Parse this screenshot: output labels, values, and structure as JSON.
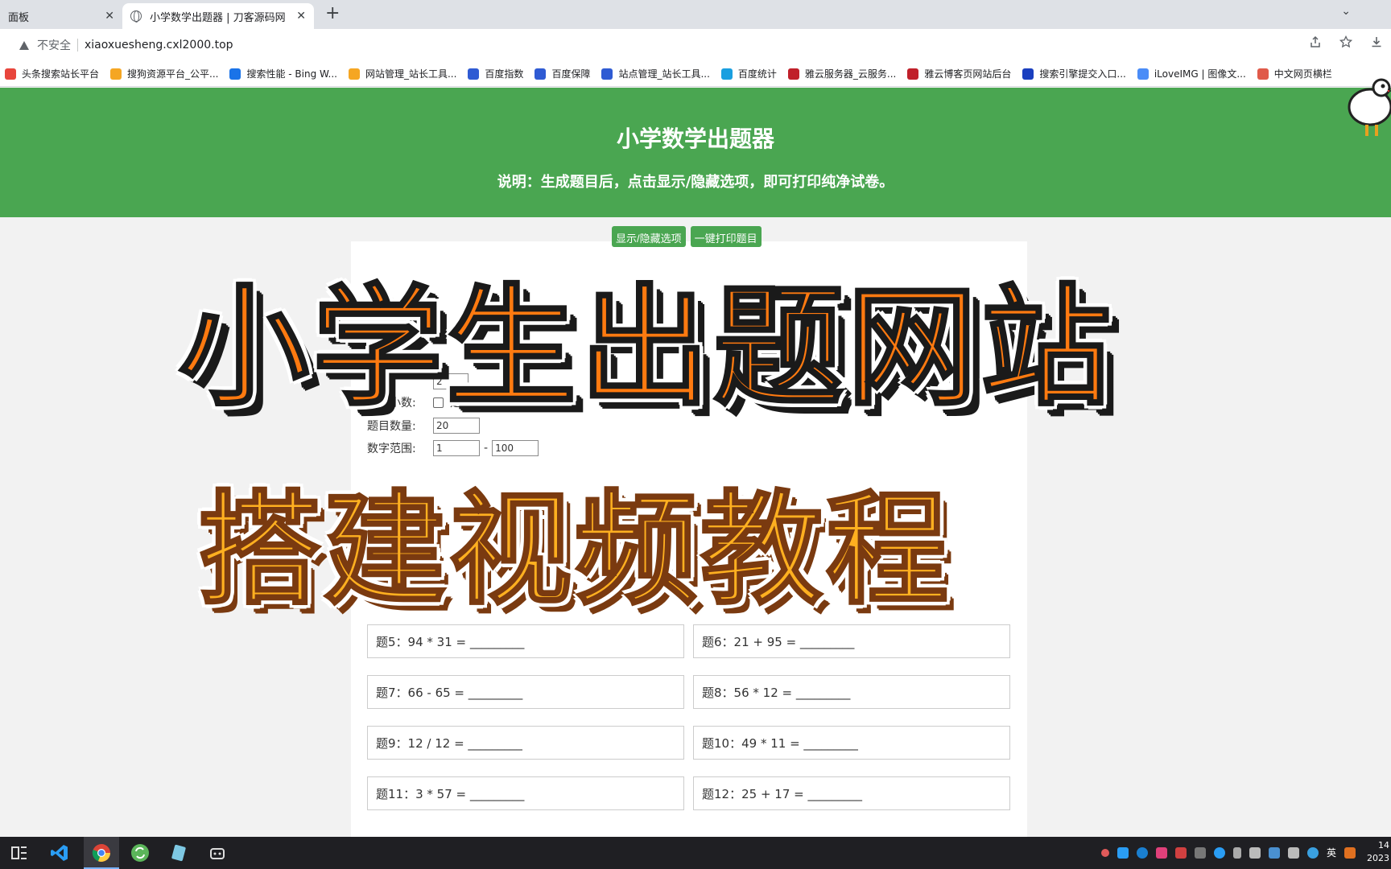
{
  "browser": {
    "tabs": [
      {
        "title": "面板",
        "active": false
      },
      {
        "title": "小学数学出题器 | 刀客源码网",
        "active": true
      }
    ],
    "close_glyph": "✕",
    "new_tab_glyph": "+",
    "tab_menu_glyph": "⌄",
    "insecure_label": "不安全",
    "url": "xiaoxuesheng.cxl2000.top",
    "bookmarks": [
      {
        "label": "头条搜索站长平台",
        "color": "#e8453c"
      },
      {
        "label": "搜狗资源平台_公平...",
        "color": "#f5a623"
      },
      {
        "label": "搜索性能 - Bing W...",
        "color": "#1a73e8"
      },
      {
        "label": "网站管理_站长工具...",
        "color": "#f5a623"
      },
      {
        "label": "百度指数",
        "color": "#2f5bd3"
      },
      {
        "label": "百度保障",
        "color": "#2f5bd3"
      },
      {
        "label": "站点管理_站长工具...",
        "color": "#2f5bd3"
      },
      {
        "label": "百度统计",
        "color": "#1a9fe0"
      },
      {
        "label": "雅云服务器_云服务...",
        "color": "#c0202a"
      },
      {
        "label": "雅云博客页网站后台",
        "color": "#c0202a"
      },
      {
        "label": "搜索引擎提交入口...",
        "color": "#1a3fbf"
      },
      {
        "label": "iLoveIMG | 图像文...",
        "color": "#4a8cf7"
      },
      {
        "label": "中文网页横栏",
        "color": "#e05a4a"
      }
    ]
  },
  "page": {
    "title": "小学数学出题器",
    "subtitle": "说明：生成题目后，点击显示/隐藏选项，即可打印纯净试卷。",
    "buttons": {
      "toggle_label": "显示/隐藏选项",
      "print_label": "一键打印题目"
    },
    "options": {
      "digits_value": "2",
      "allow_label": "允许小数:",
      "allow_checkbox": "是",
      "count_label": "题目数量:",
      "count_value": "20",
      "range_label": "数字范围:",
      "range_min": "1",
      "range_dash": "-",
      "range_max": "100"
    },
    "questions": [
      "题5：94 * 31 = _________",
      "题6：21 + 95 = _________",
      "题7：66 - 65 = _________",
      "题8：56 * 12 = _________",
      "题9：12 / 12 = _________",
      "题10：49 * 11 = _________",
      "题11：3 * 57 = _________",
      "题12：25 + 17 = _________"
    ]
  },
  "overlay": {
    "line1": "小学生出题网站",
    "line2": "搭建视频教程"
  },
  "taskbar": {
    "ime": "英",
    "time": "14",
    "date": "2023"
  },
  "colors": {
    "header_green": "#4aa651",
    "overlay_orange": "#ff7a10",
    "overlay_yellow": "#ffb020"
  }
}
